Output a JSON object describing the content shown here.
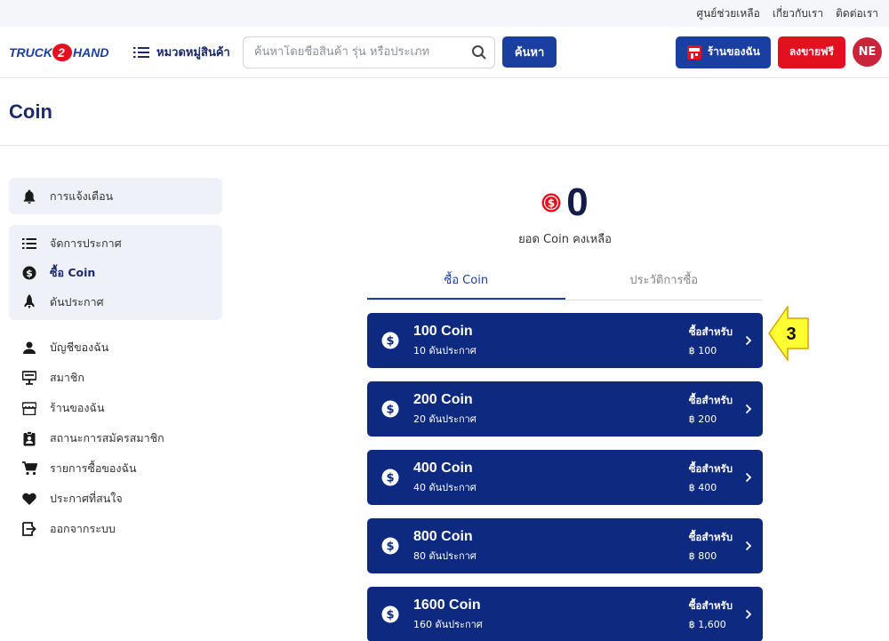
{
  "topbar": {
    "links": [
      "ศูนย์ช่วยเหลือ",
      "เกี่ยวกับเรา",
      "ติดต่อเรา"
    ]
  },
  "header": {
    "logo_left": "TRUCK",
    "logo_mid": "2",
    "logo_right": "HAND",
    "category_label": "หมวดหมู่สินค้า",
    "search_placeholder": "ค้นหาโดยชื่อสินค้า รุ่น หรือประเภท",
    "search_button": "ค้นหา",
    "shop_button": "ร้านของฉัน",
    "sell_button": "ลงขายฟรี",
    "avatar_initials": "NE"
  },
  "page": {
    "title": "Coin"
  },
  "sidebar": {
    "notify": "การแจ้งเตือน",
    "group": [
      "จัดการประกาศ",
      "ซื้อ Coin",
      "ดันประกาศ"
    ],
    "plain": [
      "บัญชีของฉัน",
      "สมาชิก",
      "ร้านของฉัน",
      "สถานะการสมัครสมาชิก",
      "รายการซื้อของฉัน",
      "ประกาศที่สนใจ",
      "ออกจากระบบ"
    ]
  },
  "balance": {
    "value": "0",
    "label": "ยอด Coin คงเหลือ"
  },
  "tabs": [
    "ซื้อ Coin",
    "ประวัติการซื้อ"
  ],
  "packages": [
    {
      "name": "100 Coin",
      "desc": "10 ดันประกาศ",
      "buy": "ซื้อสำหรับ",
      "price": "฿ 100"
    },
    {
      "name": "200 Coin",
      "desc": "20 ดันประกาศ",
      "buy": "ซื้อสำหรับ",
      "price": "฿ 200"
    },
    {
      "name": "400 Coin",
      "desc": "40 ดันประกาศ",
      "buy": "ซื้อสำหรับ",
      "price": "฿ 400"
    },
    {
      "name": "800 Coin",
      "desc": "80 ดันประกาศ",
      "buy": "ซื้อสำหรับ",
      "price": "฿ 800"
    },
    {
      "name": "1600 Coin",
      "desc": "160 ดันประกาศ",
      "buy": "ซื้อสำหรับ",
      "price": "฿ 1,600"
    }
  ],
  "callout": {
    "number": "3"
  },
  "colors": {
    "primary": "#1b3fa0",
    "package_bg": "#0e2a80",
    "sell_red": "#e3101f",
    "callout_yellow": "#ffff33"
  }
}
